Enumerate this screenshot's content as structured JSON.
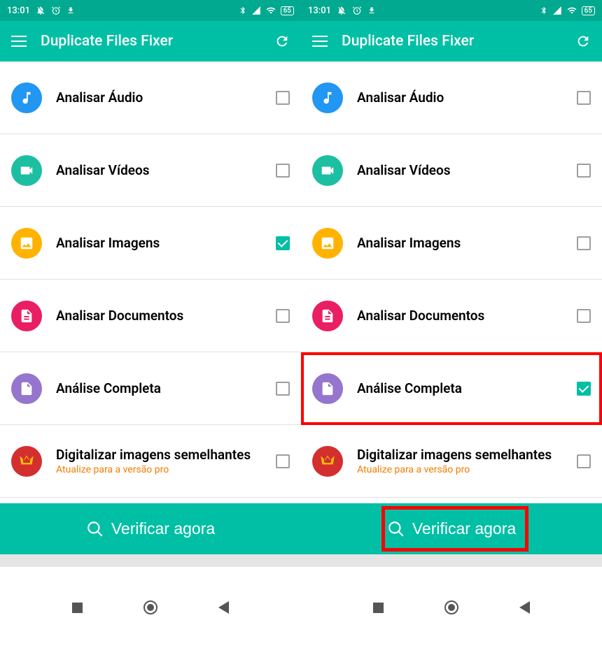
{
  "status": {
    "time": "13:01",
    "battery": "65"
  },
  "appBar": {
    "title": "Duplicate Files Fixer"
  },
  "screens": [
    {
      "items": [
        {
          "label": "Analisar Áudio",
          "iconClass": "icon-blue",
          "iconType": "music",
          "checked": false,
          "highlighted": false
        },
        {
          "label": "Analisar Vídeos",
          "iconClass": "icon-teal",
          "iconType": "video",
          "checked": false,
          "highlighted": false
        },
        {
          "label": "Analisar Imagens",
          "iconClass": "icon-orange",
          "iconType": "image",
          "checked": true,
          "highlighted": false
        },
        {
          "label": "Analisar Documentos",
          "iconClass": "icon-pink",
          "iconType": "document",
          "checked": false,
          "highlighted": false
        },
        {
          "label": "Análise Completa",
          "iconClass": "icon-purple",
          "iconType": "file",
          "checked": false,
          "highlighted": false
        },
        {
          "label": "Digitalizar imagens semelhantes",
          "subtitle": "Atualize para a versão pro",
          "iconClass": "icon-red",
          "iconType": "crown",
          "checked": false,
          "highlighted": false
        }
      ],
      "buttonHighlighted": false
    },
    {
      "items": [
        {
          "label": "Analisar Áudio",
          "iconClass": "icon-blue",
          "iconType": "music",
          "checked": false,
          "highlighted": false
        },
        {
          "label": "Analisar Vídeos",
          "iconClass": "icon-teal",
          "iconType": "video",
          "checked": false,
          "highlighted": false
        },
        {
          "label": "Analisar Imagens",
          "iconClass": "icon-orange",
          "iconType": "image",
          "checked": false,
          "highlighted": false
        },
        {
          "label": "Analisar Documentos",
          "iconClass": "icon-pink",
          "iconType": "document",
          "checked": false,
          "highlighted": false
        },
        {
          "label": "Análise Completa",
          "iconClass": "icon-purple",
          "iconType": "file",
          "checked": true,
          "highlighted": true
        },
        {
          "label": "Digitalizar imagens semelhantes",
          "subtitle": "Atualize para a versão pro",
          "iconClass": "icon-red",
          "iconType": "crown",
          "checked": false,
          "highlighted": false
        }
      ],
      "buttonHighlighted": true
    }
  ],
  "verifyButton": {
    "label": "Verificar agora"
  }
}
